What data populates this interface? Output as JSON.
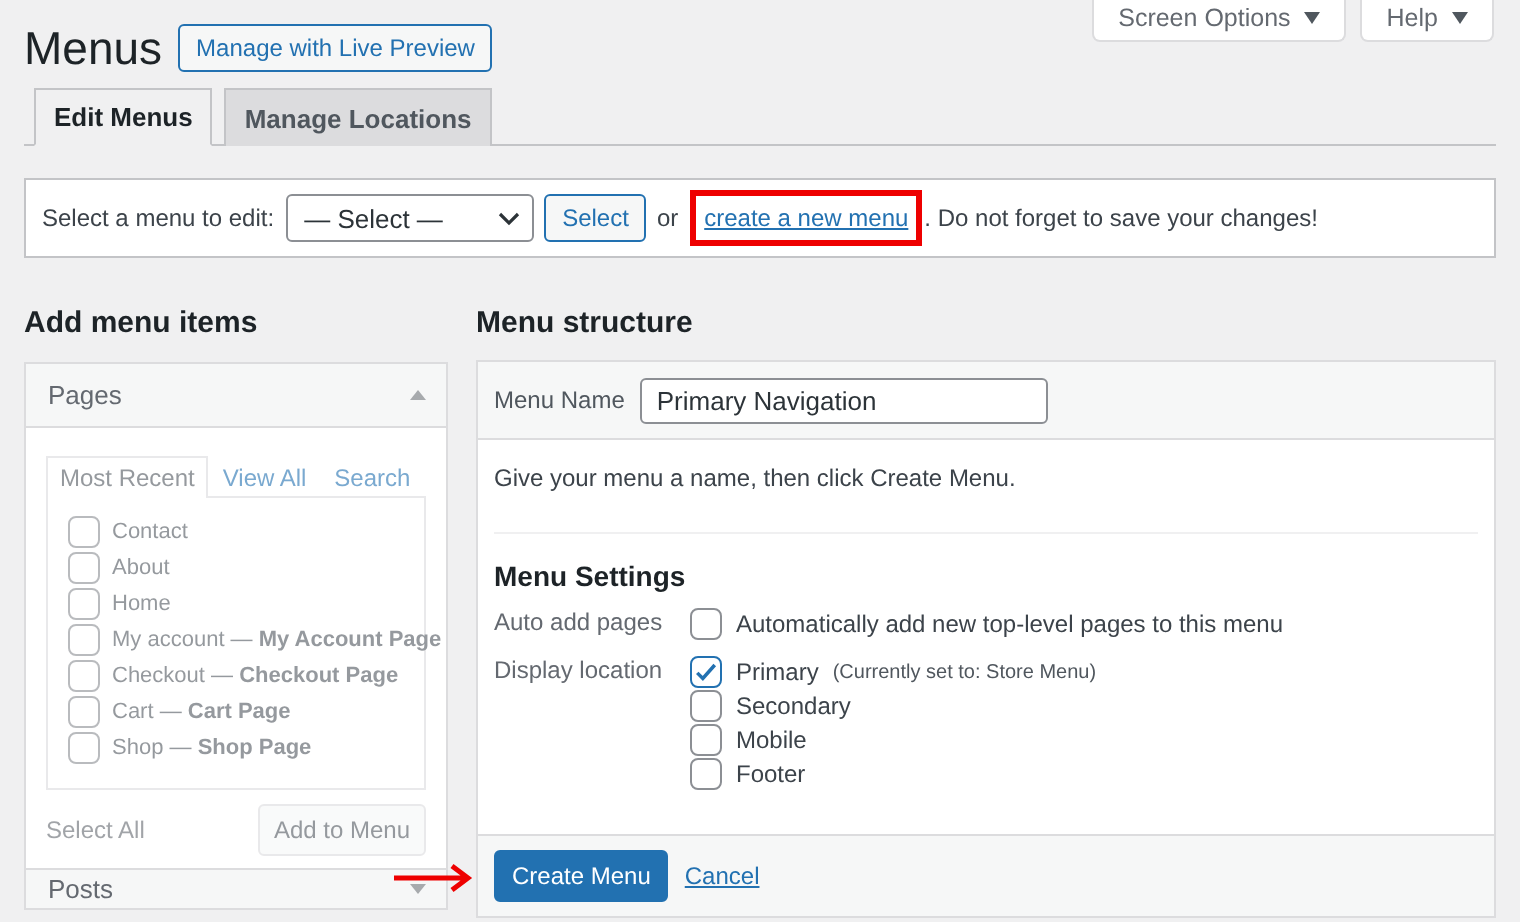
{
  "page_title": "Menus",
  "live_preview_button": "Manage with Live Preview",
  "screen_meta": [
    {
      "label": "Screen Options",
      "expanded": false
    },
    {
      "label": "Help",
      "expanded": false
    }
  ],
  "tabs": [
    {
      "label": "Edit Menus",
      "selected": true
    },
    {
      "label": "Manage Locations",
      "selected": false
    }
  ],
  "select_bar": {
    "label": "Select a menu to edit:",
    "select_value": "— Select —",
    "select_button": "Select",
    "text_before_link": "or",
    "link": "create a new menu",
    "link_highlighted": true,
    "text_after_link": ". Do not forget to save your changes!"
  },
  "add_items": {
    "heading": "Add menu items",
    "disabled": true,
    "sections": [
      {
        "title": "Pages",
        "expanded": true
      },
      {
        "title": "Posts",
        "expanded": false
      }
    ],
    "tabs": [
      {
        "label": "Most Recent",
        "selected": true
      },
      {
        "label": "View All",
        "selected": false
      },
      {
        "label": "Search",
        "selected": false
      }
    ],
    "items": [
      {
        "label": "Contact",
        "checked": false
      },
      {
        "label": "About",
        "checked": false
      },
      {
        "label": "Home",
        "checked": false
      },
      {
        "label": "My account — **My Account Page**",
        "checked": false
      },
      {
        "label": "Checkout — **Checkout Page**",
        "checked": false
      },
      {
        "label": "Cart — **Cart Page**",
        "checked": false
      },
      {
        "label": "Shop — **Shop Page**",
        "checked": false
      }
    ],
    "select_all": "Select All",
    "add_button": "Add to Menu"
  },
  "menu_structure": {
    "heading": "Menu structure",
    "name_label": "Menu Name",
    "name_value": "Primary Navigation",
    "hint": "Give your menu a name, then click Create Menu.",
    "settings_heading": "Menu Settings",
    "settings": [
      {
        "label": "Auto add pages",
        "options": [
          {
            "label": "Automatically add new top-level pages to this menu",
            "checked": false
          }
        ]
      },
      {
        "label": "Display location",
        "options": [
          {
            "label": "Primary",
            "note": "(Currently set to: Store Menu)",
            "checked": true
          },
          {
            "label": "Secondary",
            "checked": false
          },
          {
            "label": "Mobile",
            "checked": false
          },
          {
            "label": "Footer",
            "checked": false
          }
        ]
      }
    ],
    "create_button": "Create Menu",
    "create_button_pointed": true,
    "cancel_link": "Cancel"
  }
}
